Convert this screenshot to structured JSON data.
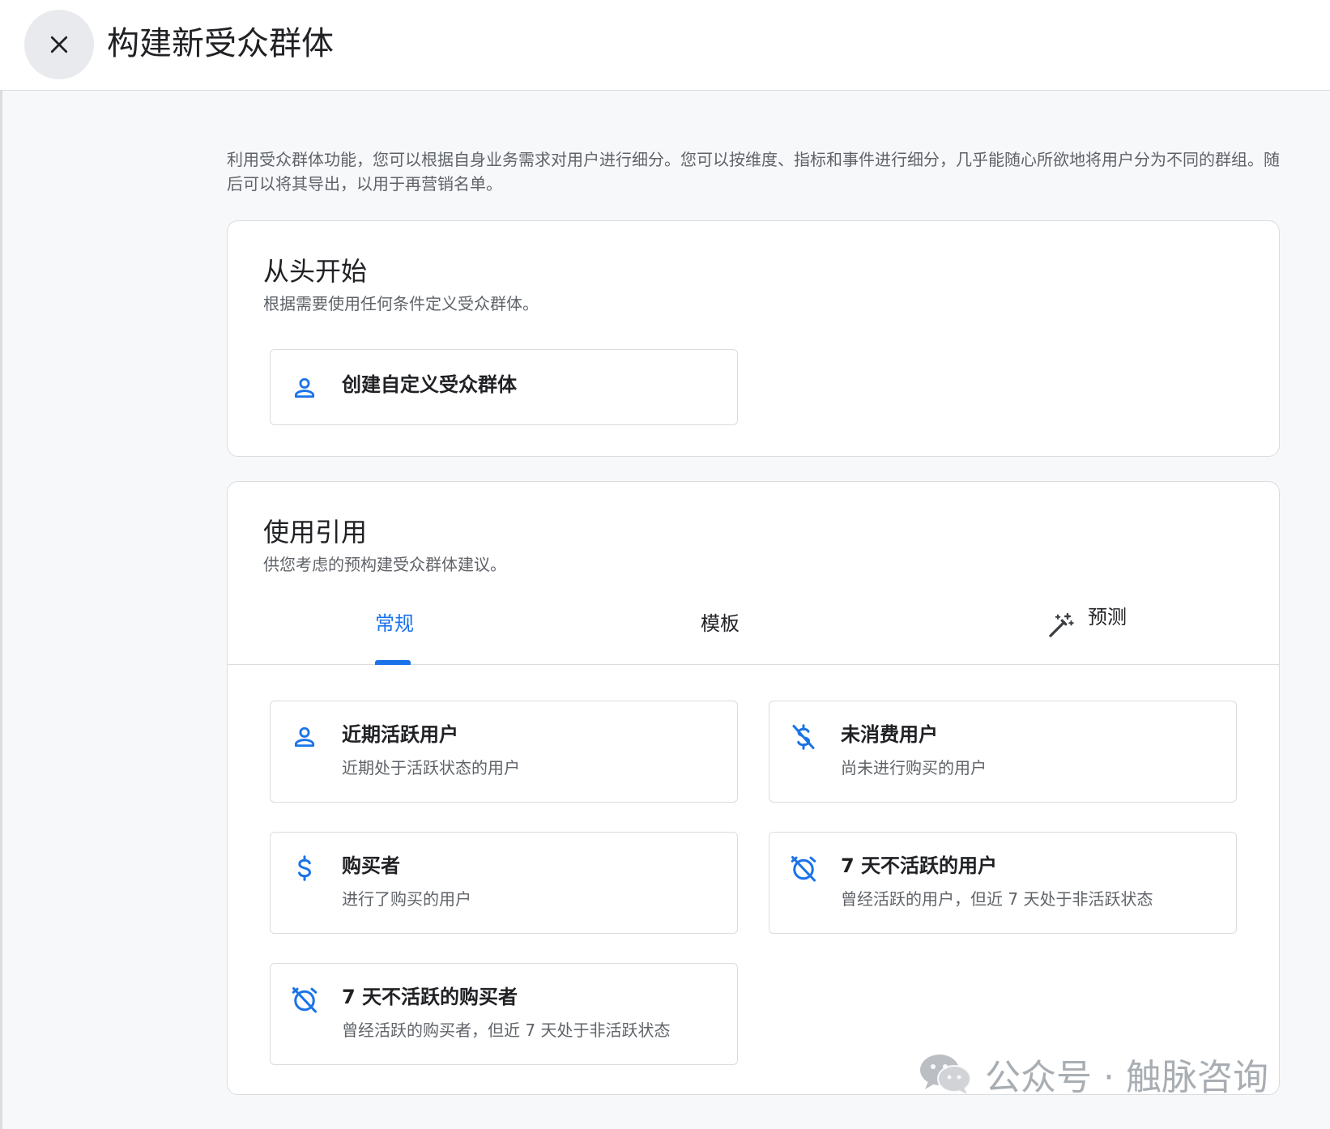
{
  "header": {
    "title": "构建新受众群体"
  },
  "intro": "利用受众群体功能，您可以根据自身业务需求对用户进行细分。您可以按维度、指标和事件进行细分，几乎能随心所欲地将用户分为不同的群组。随后可以将其导出，以用于再营销名单。",
  "from_scratch": {
    "title": "从头开始",
    "subtitle": "根据需要使用任何条件定义受众群体。",
    "option": {
      "icon": "person-icon",
      "label": "创建自定义受众群体"
    }
  },
  "suggestions": {
    "title": "使用引用",
    "subtitle": "供您考虑的预构建受众群体建议。",
    "tabs": [
      {
        "label": "常规",
        "active": true
      },
      {
        "label": "模板",
        "active": false
      },
      {
        "label": "预测",
        "active": false,
        "icon": "magic-wand-icon"
      }
    ],
    "items": [
      {
        "icon": "person-icon",
        "title": "近期活跃用户",
        "desc": "近期处于活跃状态的用户"
      },
      {
        "icon": "money-off-icon",
        "title": "未消费用户",
        "desc": "尚未进行购买的用户"
      },
      {
        "icon": "dollar-icon",
        "title": "购买者",
        "desc": "进行了购买的用户"
      },
      {
        "icon": "alarm-off-icon",
        "title": "7 天不活跃的用户",
        "desc": "曾经活跃的用户，但近 7 天处于非活跃状态"
      },
      {
        "icon": "alarm-off-icon",
        "title": "7 天不活跃的购买者",
        "desc": "曾经活跃的购买者，但近 7 天处于非活跃状态"
      }
    ]
  },
  "watermark": {
    "text": "公众号 · 触脉咨询"
  },
  "colors": {
    "accent": "#1a73e8",
    "text": "#202124",
    "secondary": "#5f6368",
    "border": "#dadce0"
  }
}
